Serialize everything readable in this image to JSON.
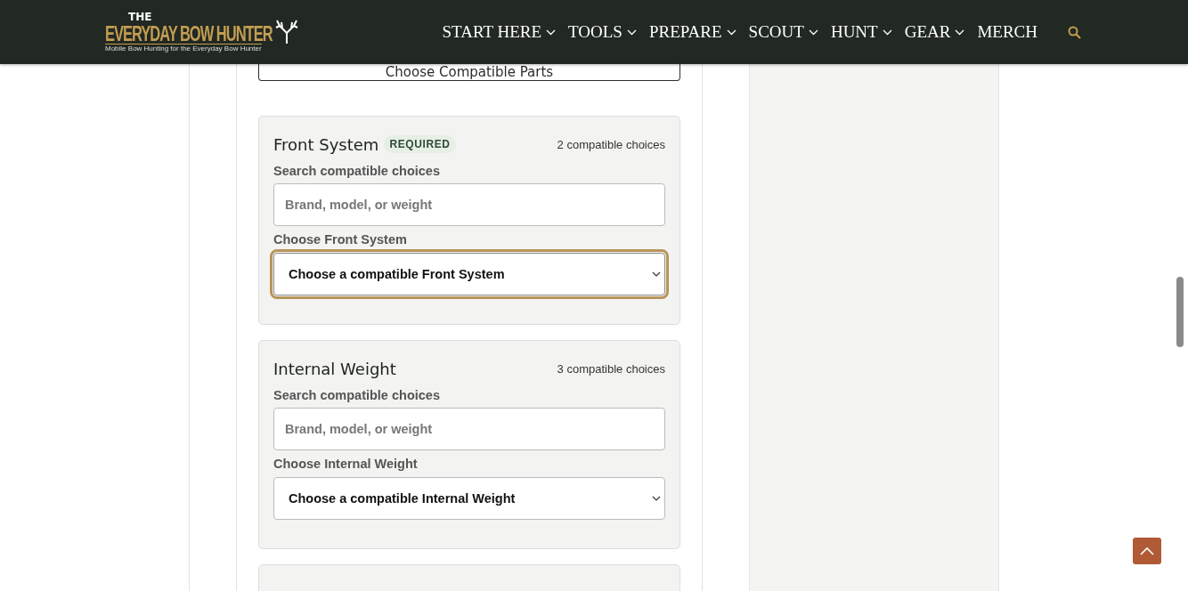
{
  "header": {
    "logo": {
      "top": "THE",
      "main": "EVERYDAY BOW HUNTER",
      "tagline": "Mobile Bow Hunting for the Everyday Bow Hunter"
    },
    "nav": [
      {
        "label": "START HERE",
        "has_menu": true
      },
      {
        "label": "TOOLS",
        "has_menu": true
      },
      {
        "label": "PREPARE",
        "has_menu": true
      },
      {
        "label": "SCOUT",
        "has_menu": true
      },
      {
        "label": "HUNT",
        "has_menu": true
      },
      {
        "label": "GEAR",
        "has_menu": true
      },
      {
        "label": "MERCH",
        "has_menu": false
      }
    ]
  },
  "parts_button": "Choose Compatible Parts",
  "sections": [
    {
      "title": "Front System",
      "badge": "REQUIRED",
      "count": "2 compatible choices",
      "search_label": "Search compatible choices",
      "search_placeholder": "Brand, model, or weight",
      "select_label": "Choose Front System",
      "select_value": "Choose a compatible Front System",
      "focused": true
    },
    {
      "title": "Internal Weight",
      "count": "3 compatible choices",
      "search_label": "Search compatible choices",
      "search_placeholder": "Brand, model, or weight",
      "select_label": "Choose Internal Weight",
      "select_value": "Choose a compatible Internal Weight",
      "focused": false
    }
  ]
}
